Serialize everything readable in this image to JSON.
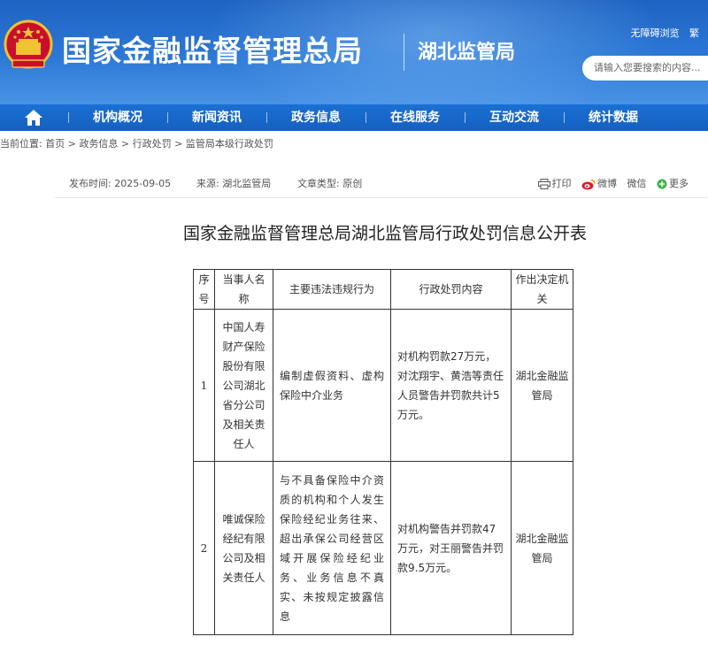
{
  "header": {
    "site_title": "国家金融监督管理总局",
    "sub_title": "湖北监管局",
    "accessibility_link": "无障碍浏览",
    "traditional_link": "繁",
    "search_placeholder": "请输入您要搜索的内容..."
  },
  "nav": {
    "items": [
      "机构概况",
      "新闻资讯",
      "政务信息",
      "在线服务",
      "互动交流",
      "统计数据"
    ]
  },
  "breadcrumb": {
    "label": "当前位置:",
    "items": [
      "首页",
      "政务信息",
      "行政处罚",
      "监管局本级行政处罚"
    ],
    "separator": " > "
  },
  "meta": {
    "publish_time": "发布时间:  2025-09-05",
    "source": "来源:  湖北监管局",
    "doc_type": "文章类型:  原创",
    "print": "打印",
    "weibo": "微博",
    "wechat": "微信",
    "more": "更多"
  },
  "article": {
    "title": "国家金融监督管理总局湖北监管局行政处罚信息公开表"
  },
  "table": {
    "headers": [
      "序号",
      "当事人名称",
      "主要违法违规行为",
      "行政处罚内容",
      "作出决定机关"
    ],
    "rows": [
      {
        "no": "1",
        "party": "中国人寿财产保险股份有限公司湖北省分公司及相关责任人",
        "violation": "编制虚假资料、虚构保险中介业务",
        "penalty": "对机构罚款27万元，对沈翔宇、黄浩等责任人员警告并罚款共计5万元。",
        "authority": "湖北金融监管局"
      },
      {
        "no": "2",
        "party": "唯诚保险经纪有限公司及相关责任人",
        "violation": "与不具备保险中介资质的机构和个人发生保险经纪业务往来、超出承保公司经营区域开展保险经纪业务、业务信息不真实、未按规定披露信息",
        "penalty": "对机构警告并罚款47万元，对王丽警告并罚款9.5万元。",
        "authority": "湖北金融监管局"
      }
    ]
  },
  "colors": {
    "header_blue": "#2c78d6",
    "nav_blue": "#1560bf",
    "table_border": "#333333"
  }
}
